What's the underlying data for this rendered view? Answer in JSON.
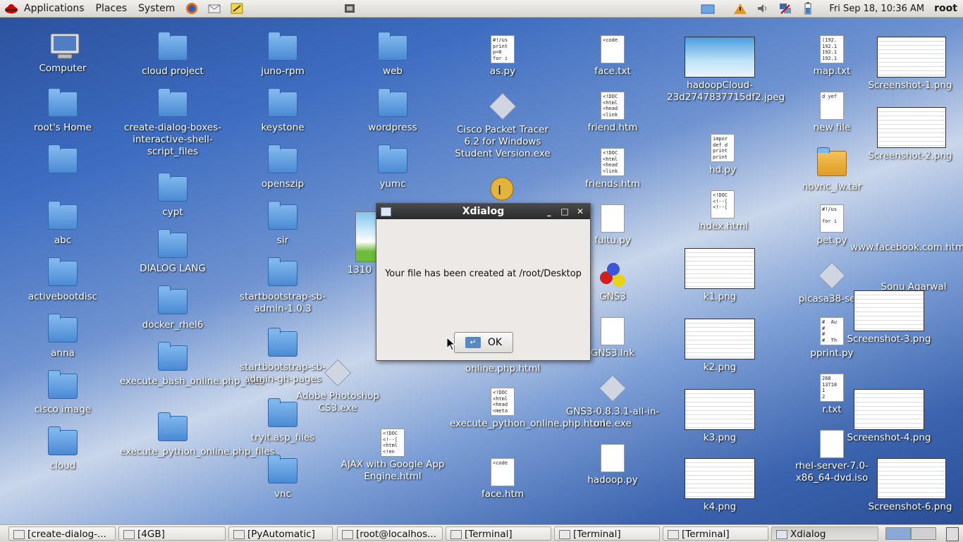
{
  "top_panel": {
    "menus": [
      "Applications",
      "Places",
      "System"
    ],
    "clock": "Fri Sep 18, 10:36 AM",
    "user": "root"
  },
  "desktop": {
    "icons": [
      {
        "label": "Computer",
        "kind": "computer"
      },
      {
        "label": "root's Home",
        "kind": "home"
      },
      {
        "label": "",
        "kind": "folder"
      },
      {
        "label": "abc",
        "kind": "folder"
      },
      {
        "label": "activebootdisc",
        "kind": "folder"
      },
      {
        "label": "anna",
        "kind": "folder"
      },
      {
        "label": "cisco image",
        "kind": "folder"
      },
      {
        "label": "cloud",
        "kind": "folder"
      },
      {
        "label": "cloud project",
        "kind": "folder"
      },
      {
        "label": "create-dialog-boxes-interactive-shell-script_files",
        "kind": "folder"
      },
      {
        "label": "cypt",
        "kind": "folder"
      },
      {
        "label": "DIALOG LANG",
        "kind": "folder"
      },
      {
        "label": "docker_rhel6",
        "kind": "folder"
      },
      {
        "label": "execute_bash_online.php_files",
        "kind": "folder"
      },
      {
        "label": "execute_python_online.php_files",
        "kind": "folder"
      },
      {
        "label": "juno-rpm",
        "kind": "folder"
      },
      {
        "label": "keystone",
        "kind": "folder"
      },
      {
        "label": "openszip",
        "kind": "folder"
      },
      {
        "label": "sir",
        "kind": "folder"
      },
      {
        "label": "startbootstrap-sb-admin-1.0.3",
        "kind": "folder"
      },
      {
        "label": "startbootstrap-sb-admin-gh-pages",
        "kind": "folder"
      },
      {
        "label": "tryit.asp_files",
        "kind": "folder"
      },
      {
        "label": "vnc",
        "kind": "folder"
      },
      {
        "label": "web",
        "kind": "folder"
      },
      {
        "label": "wordpress",
        "kind": "folder"
      },
      {
        "label": "yumc",
        "kind": "folder"
      },
      {
        "label": "Adobe Photoshop CS3.exe",
        "kind": "exe"
      },
      {
        "label": "AJAX with Google App Engine.html",
        "kind": "doc"
      },
      {
        "label": "as.py",
        "kind": "doc"
      },
      {
        "label": "Cisco Packet Tracer 6.2 for Windows Student Version.exe",
        "kind": "exe"
      },
      {
        "label": "online.php.html",
        "kind": "doc"
      },
      {
        "label": "execute_python_online.php.html",
        "kind": "doc"
      },
      {
        "label": "face.htm",
        "kind": "doc"
      },
      {
        "label": "face.txt",
        "kind": "doc"
      },
      {
        "label": "friend.htm",
        "kind": "doc"
      },
      {
        "label": "friends.htm",
        "kind": "doc"
      },
      {
        "label": "fultu.py",
        "kind": "doc"
      },
      {
        "label": "GNS3",
        "kind": "gns3"
      },
      {
        "label": "GNS3.lnk",
        "kind": "doc"
      },
      {
        "label": "GNS3-0.8.3.1-all-in-one.exe",
        "kind": "exe"
      },
      {
        "label": "hadoop.py",
        "kind": "doc"
      },
      {
        "label": "hadoopCloud-23d2747837715df2.jpeg",
        "kind": "thumb"
      },
      {
        "label": "hd.py",
        "kind": "doc"
      },
      {
        "label": "index.html",
        "kind": "doc"
      },
      {
        "label": "k1.png",
        "kind": "thumb"
      },
      {
        "label": "k2.png",
        "kind": "thumb"
      },
      {
        "label": "k3.png",
        "kind": "thumb"
      },
      {
        "label": "k4.png",
        "kind": "thumb"
      },
      {
        "label": "map.txt",
        "kind": "doc"
      },
      {
        "label": "new file",
        "kind": "doc"
      },
      {
        "label": "novnc_lw.tar",
        "kind": "archive"
      },
      {
        "label": "pet.py",
        "kind": "doc"
      },
      {
        "label": "picasa38-setu",
        "kind": "exe"
      },
      {
        "label": "pprint.py",
        "kind": "doc"
      },
      {
        "label": "r.txt",
        "kind": "doc"
      },
      {
        "label": "rhel-server-7.0-x86_64-dvd.iso",
        "kind": "doc"
      },
      {
        "label": "Screenshot-1.png",
        "kind": "thumb"
      },
      {
        "label": "Screenshot-2.png",
        "kind": "thumb"
      },
      {
        "label": "Screenshot-3.png",
        "kind": "thumb"
      },
      {
        "label": "Screenshot-4.png",
        "kind": "thumb"
      },
      {
        "label": "Screenshot-6.png",
        "kind": "thumb"
      },
      {
        "label": "www.facebook.com.htm",
        "kind": "doc"
      },
      {
        "label": "Sonu Agarwal",
        "kind": "doc"
      },
      {
        "label": "1310",
        "kind": "image"
      }
    ]
  },
  "dialog": {
    "title": "Xdialog",
    "message": "Your file has been created at /root/Desktop",
    "ok_label": "OK"
  },
  "taskbar": {
    "tasks": [
      "[create-dialog-...",
      "[4GB]",
      "[PyAutomatic]",
      "[root@localhos...",
      "[Terminal]",
      "[Terminal]",
      "[Terminal]",
      "Xdialog"
    ]
  }
}
